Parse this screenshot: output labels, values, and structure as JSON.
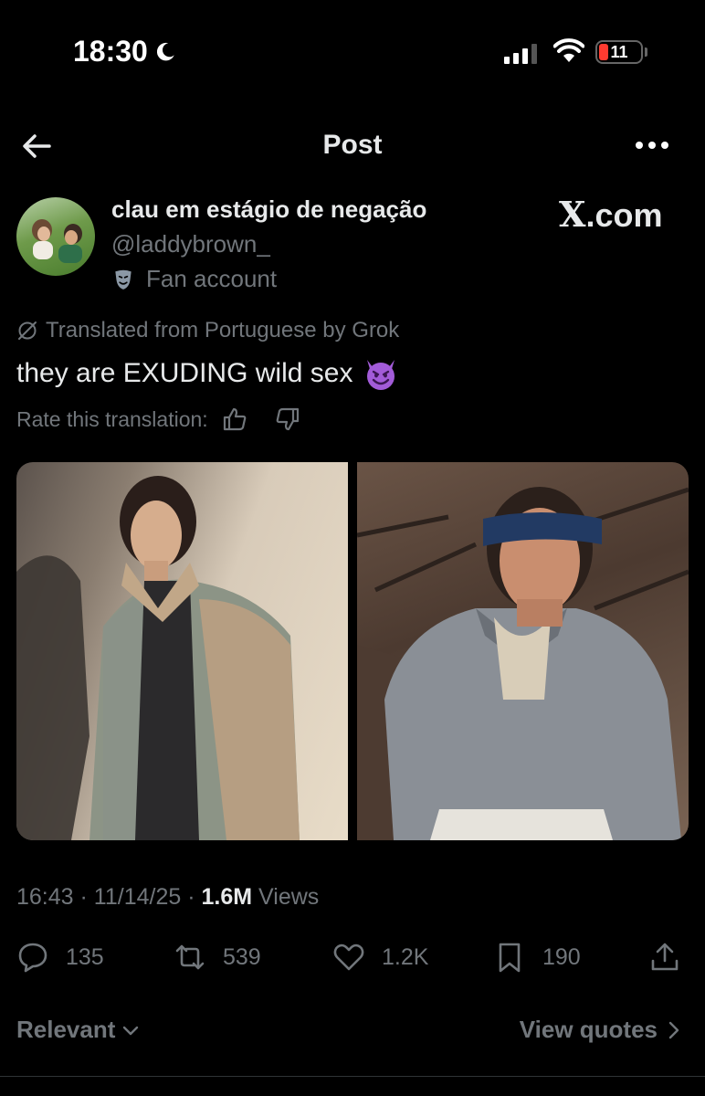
{
  "status_bar": {
    "time": "18:30",
    "battery_level": "11",
    "battery_color": "#ff3b30"
  },
  "nav": {
    "title": "Post",
    "back_icon": "arrow-left-icon",
    "more_icon": "more-horizontal-icon"
  },
  "author": {
    "display_name": "clau em estágio de negação",
    "handle": "@laddybrown_",
    "label_icon": "theater-mask-icon",
    "label": "Fan account"
  },
  "watermark": {
    "letter": "X",
    "text": ".com"
  },
  "post": {
    "translation_notice": "Translated from Portuguese by Grok",
    "text": "they are EXUDING wild sex",
    "emoji_icon": "smiling-devil-icon",
    "rate_label": "Rate this translation:"
  },
  "media": {
    "count": 2
  },
  "meta": {
    "time": "16:43",
    "date": "11/14/25",
    "views_count": "1.6M",
    "views_label": "Views"
  },
  "actions": {
    "replies": "135",
    "reposts": "539",
    "likes": "1.2K",
    "bookmarks": "190"
  },
  "footer": {
    "sort_label": "Relevant",
    "quotes_label": "View quotes"
  },
  "colors": {
    "background": "#000000",
    "text_primary": "#e7e9ea",
    "text_secondary": "#71767b",
    "emoji_purple": "#a25bd8"
  }
}
